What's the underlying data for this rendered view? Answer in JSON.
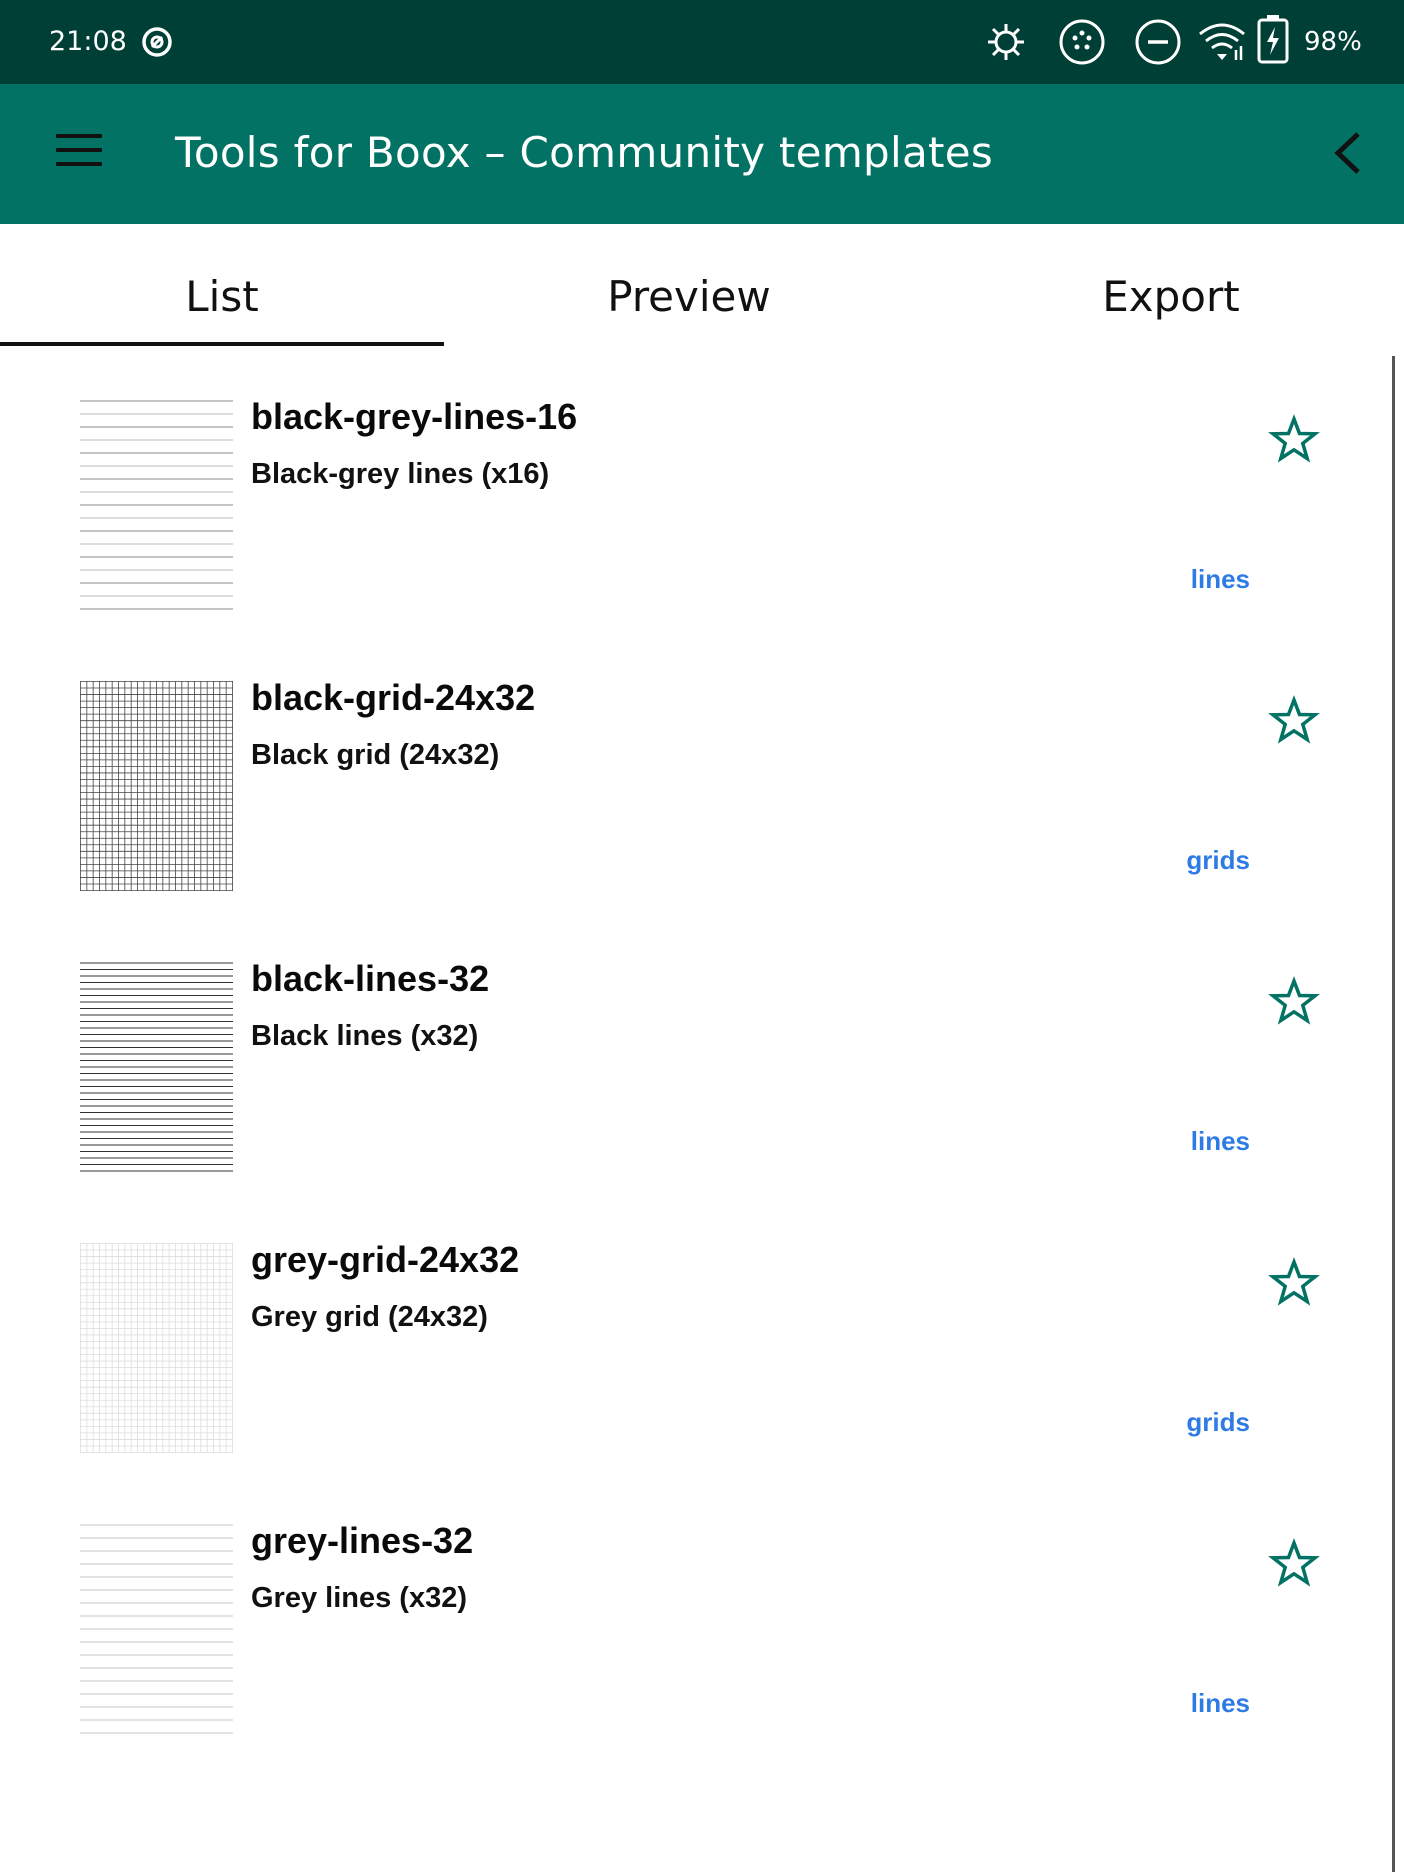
{
  "statusbar": {
    "time": "21:08",
    "battery": "98%",
    "icons": [
      "sync-icon",
      "brightness-icon",
      "refresh-icon",
      "do-not-disturb-icon",
      "wifi-icon",
      "battery-icon"
    ]
  },
  "appbar": {
    "title": "Tools for Boox – Community templates",
    "menu_icon": "hamburger-menu-icon",
    "back_icon": "chevron-left-icon"
  },
  "tabs": [
    {
      "label": "List",
      "active": true
    },
    {
      "label": "Preview",
      "active": false
    },
    {
      "label": "Export",
      "active": false
    }
  ],
  "templates": [
    {
      "name": "black-grey-lines-16",
      "description": "Black-grey lines (x16)",
      "category": "lines",
      "thumbnail": "black-grey-lines"
    },
    {
      "name": "black-grid-24x32",
      "description": "Black grid (24x32)",
      "category": "grids",
      "thumbnail": "black-grid"
    },
    {
      "name": "black-lines-32",
      "description": "Black lines (x32)",
      "category": "lines",
      "thumbnail": "black-lines"
    },
    {
      "name": "grey-grid-24x32",
      "description": "Grey grid (24x32)",
      "category": "grids",
      "thumbnail": "grey-grid"
    },
    {
      "name": "grey-lines-32",
      "description": "Grey lines (x32)",
      "category": "lines",
      "thumbnail": "grey-lines"
    }
  ],
  "colors": {
    "statusbar": "#003f35",
    "appbar": "#017263",
    "accent_star": "#017263",
    "tag": "#2f7be6"
  }
}
